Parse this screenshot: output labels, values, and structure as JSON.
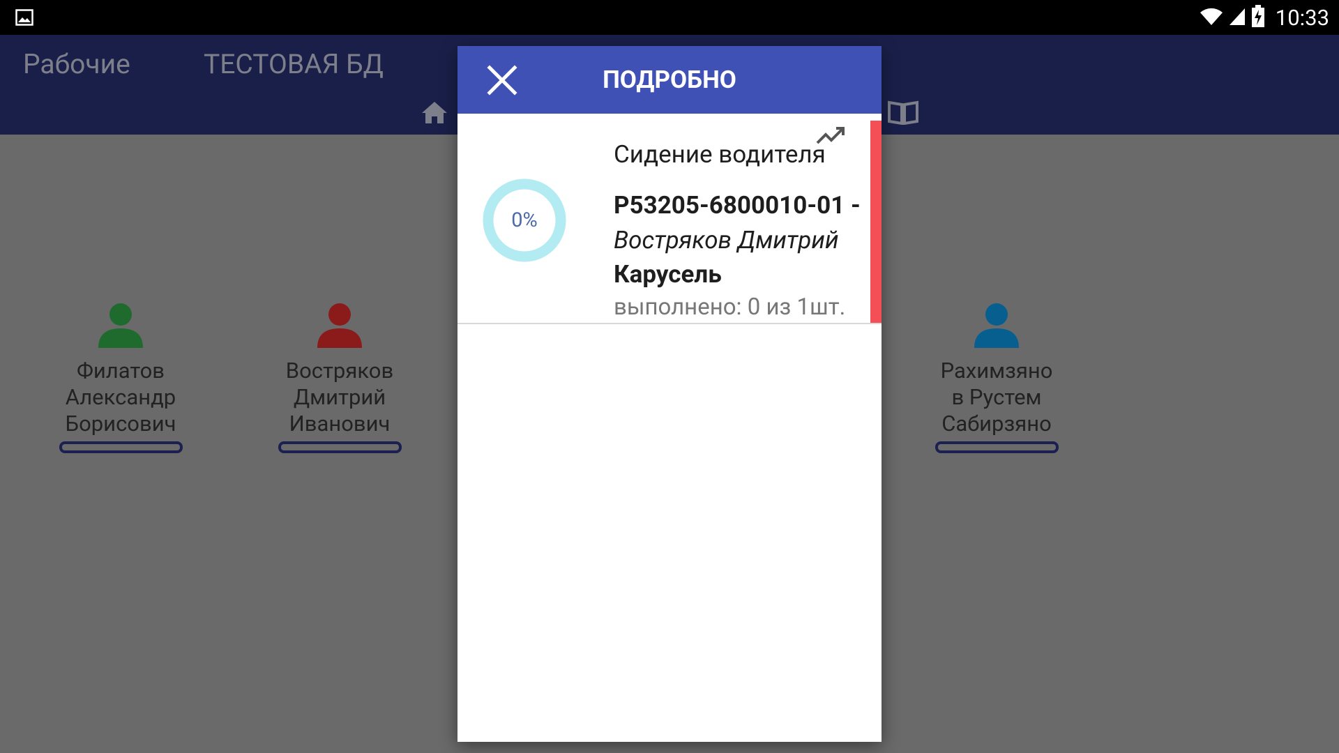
{
  "status_bar": {
    "time": "10:33",
    "icons": [
      "gallery-icon",
      "wifi-icon",
      "signal-icon",
      "battery-charging-icon"
    ]
  },
  "app_bar": {
    "title": "Рабочие",
    "database": "ТЕСТОВАЯ БД",
    "icons": [
      "home-icon",
      "book-icon"
    ]
  },
  "workers": [
    {
      "name_lines": [
        "Филатов",
        "Александр",
        "Борисович"
      ],
      "color": "#1e6b2d",
      "progress": 0
    },
    {
      "name_lines": [
        "Востряков",
        "Дмитрий",
        "Иванович"
      ],
      "color": "#8b1a1a",
      "progress": 0
    },
    {
      "name_lines": [
        "Рахимзяно",
        "в Рустем",
        "Сабирзяно"
      ],
      "color": "#075f8f",
      "progress": 0
    }
  ],
  "dialog": {
    "title": "ПОДРОБНО",
    "close_icon": "close-icon",
    "task": {
      "progress_label": "0%",
      "progress_value": 0,
      "name": "Сидение водителя",
      "code": "Р53205-6800010-01 -",
      "worker": "Востряков Дмитрий",
      "machine": "Карусель",
      "done": "выполнено: 0 из 1шт.",
      "trend_icon": "trending-up-icon",
      "accent_color": "#f44f57",
      "ring_color": "#b2ebf2"
    }
  },
  "colors": {
    "primary": "#3f51b5",
    "primary_dark": "#1a1f4a",
    "overlay": "#6a6a6a"
  }
}
